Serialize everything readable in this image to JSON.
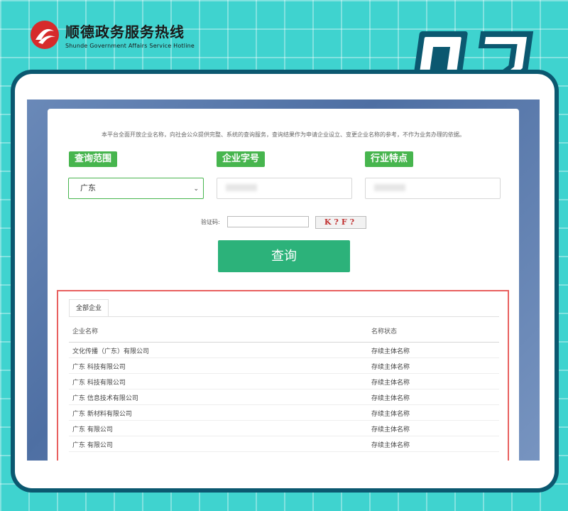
{
  "brand": {
    "title_cn": "顺德政务服务热线",
    "title_en": "Shunde Government Affairs Service Hotline"
  },
  "badge": {
    "number": "02"
  },
  "notice": "本平台全面开放企业名称，向社会公众提供完整、系统的查询服务，查询结果作为申请企业设立、变更企业名称的参考，不作为业务办理的依据。",
  "form": {
    "scope_label": "查询范围",
    "scope_value": "广东",
    "name_label": "企业字号",
    "industry_label": "行业特点",
    "captcha_label": "验证码:",
    "captcha_text": "K?F?",
    "query_button": "查询"
  },
  "results": {
    "tab": "全部企业",
    "col_name": "企业名称",
    "col_status": "名称状态",
    "rows": [
      {
        "name": "文化传播（广东）有限公司",
        "status": "存续主体名称"
      },
      {
        "name": "广东 科技有限公司",
        "status": "存续主体名称"
      },
      {
        "name": "广东 科技有限公司",
        "status": "存续主体名称"
      },
      {
        "name": "广东 信息技术有限公司",
        "status": "存续主体名称"
      },
      {
        "name": "广东 新材料有限公司",
        "status": "存续主体名称"
      },
      {
        "name": "广东 有限公司",
        "status": "存续主体名称"
      },
      {
        "name": "广东 有限公司",
        "status": "存续主体名称"
      }
    ]
  },
  "colors": {
    "background": "#3fd3cf",
    "frame": "#0b5870",
    "label_green": "#47b54e",
    "button_green": "#2cb27a",
    "highlight_red": "#e8605f"
  }
}
